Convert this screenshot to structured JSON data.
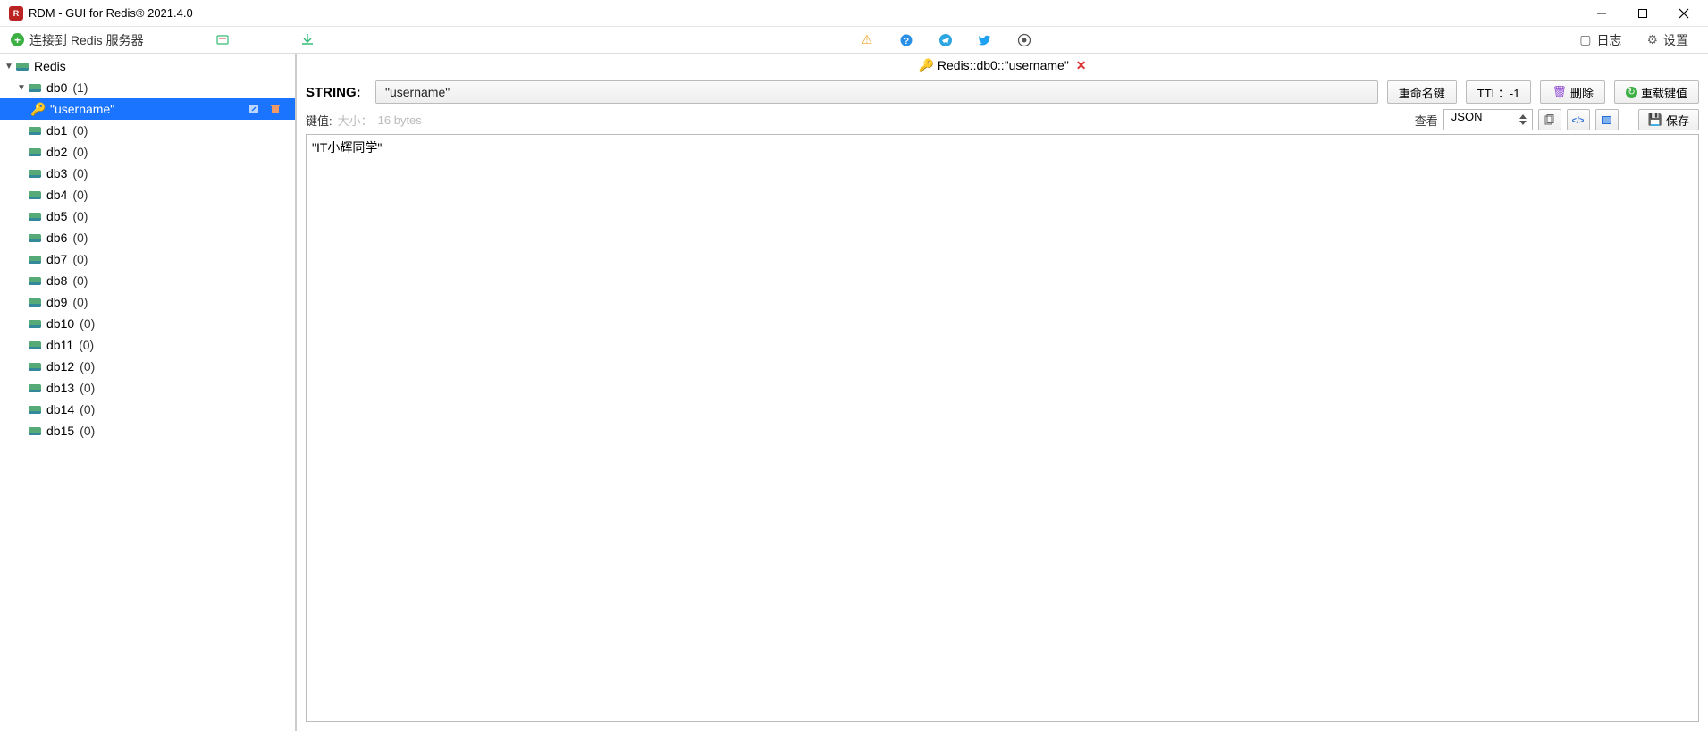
{
  "window": {
    "title": "RDM - GUI for Redis® 2021.4.0"
  },
  "toolbar": {
    "connect_label": "连接到 Redis 服务器",
    "log_label": "日志",
    "settings_label": "设置"
  },
  "tree": {
    "connection_name": "Redis",
    "databases": [
      {
        "name": "db0",
        "count": "(1)",
        "expanded": true,
        "keys": [
          {
            "name": "\"username\"",
            "selected": true
          }
        ]
      },
      {
        "name": "db1",
        "count": "(0)"
      },
      {
        "name": "db2",
        "count": "(0)"
      },
      {
        "name": "db3",
        "count": "(0)"
      },
      {
        "name": "db4",
        "count": "(0)"
      },
      {
        "name": "db5",
        "count": "(0)"
      },
      {
        "name": "db6",
        "count": "(0)"
      },
      {
        "name": "db7",
        "count": "(0)"
      },
      {
        "name": "db8",
        "count": "(0)"
      },
      {
        "name": "db9",
        "count": "(0)"
      },
      {
        "name": "db10",
        "count": "(0)"
      },
      {
        "name": "db11",
        "count": "(0)"
      },
      {
        "name": "db12",
        "count": "(0)"
      },
      {
        "name": "db13",
        "count": "(0)"
      },
      {
        "name": "db14",
        "count": "(0)"
      },
      {
        "name": "db15",
        "count": "(0)"
      }
    ]
  },
  "tab": {
    "title": "Redis::db0::\"username\""
  },
  "key_editor": {
    "type_label": "STRING:",
    "key_name": "\"username\"",
    "rename_label": "重命名键",
    "ttl_label": "TTL：-1",
    "delete_label": "删除",
    "reload_label": "重载键值"
  },
  "value_bar": {
    "value_label": "键值:",
    "size_label": "大小：",
    "size_value": "16 bytes",
    "view_label": "查看",
    "view_format": "JSON",
    "save_label": "保存"
  },
  "editor": {
    "value": "\"IT小辉同学\""
  }
}
